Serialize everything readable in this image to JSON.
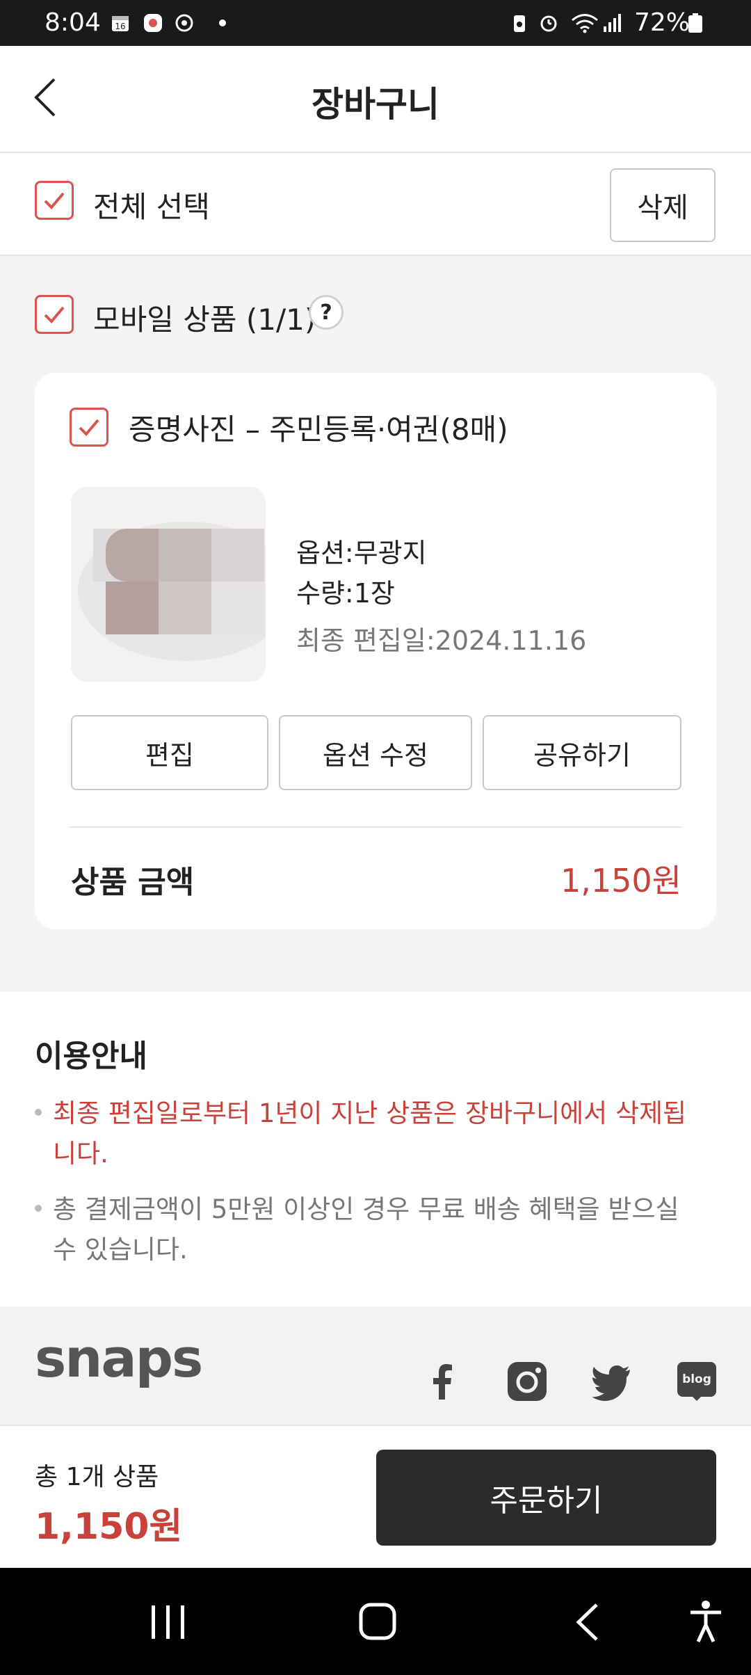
{
  "status_bar": {
    "time": "8:04",
    "battery": "72%",
    "icons": [
      "calendar-icon",
      "app-notification-icon",
      "sync-icon",
      "dot-icon",
      "battery-saver-icon",
      "alarm-icon",
      "wifi-icon",
      "signal-icon",
      "battery-icon"
    ]
  },
  "header": {
    "title": "장바구니",
    "back_icon": "chevron-left-icon"
  },
  "select_all": {
    "label": "전체 선택",
    "checked": true,
    "delete_label": "삭제"
  },
  "group": {
    "label": "모바일 상품 (1/1)",
    "checked": true,
    "help_icon": "?"
  },
  "product": {
    "checked": true,
    "title": "증명사진 – 주민등록·여권(8매)",
    "option": "옵션:무광지",
    "quantity": "수량:1장",
    "last_edit": "최종 편집일:2024.11.16",
    "buttons": {
      "edit": "편집",
      "edit_option": "옵션 수정",
      "share": "공유하기"
    },
    "amount_label": "상품 금액",
    "amount": "1,150원"
  },
  "info": {
    "heading": "이용안내",
    "note1_line1": "최종 편집일로부터 1년이 지난 상품은 장바구니에서 삭제됩",
    "note1_line2": "니다.",
    "note2_line1": "총 결제금액이 5만원 이상인 경우 무료 배송 혜택을 받으실",
    "note2_line2": "수 있습니다."
  },
  "footer": {
    "logo": "snaps",
    "social": [
      "facebook-icon",
      "instagram-icon",
      "twitter-icon",
      "blog-icon"
    ],
    "blog_text": "blog"
  },
  "order": {
    "count_label": "총 1개 상품",
    "total": "1,150원",
    "order_label": "주문하기"
  },
  "colors": {
    "accent": "#c8413a",
    "checkbox": "#d9534f",
    "order_button": "#2b2b2b",
    "background": "#f4f4f4"
  }
}
